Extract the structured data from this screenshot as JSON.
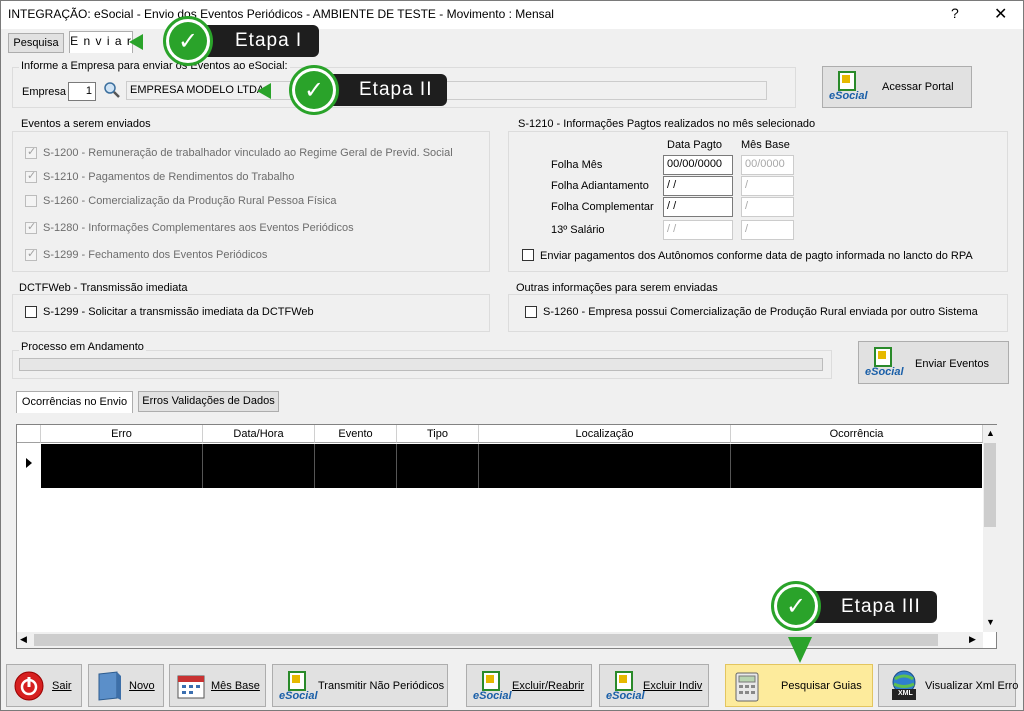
{
  "window": {
    "title": "INTEGRAÇÃO: eSocial - Envio dos Eventos Periódicos - AMBIENTE DE TESTE - Movimento : Mensal",
    "help": "?",
    "close": "✕"
  },
  "tabs": [
    {
      "label": "Pesquisa"
    },
    {
      "label": "E n v i a r"
    }
  ],
  "empresa_group": {
    "label": "Informe a Empresa para enviar os Eventos ao eSocial:",
    "empresa_label": "Empresa",
    "empresa_code": "1",
    "empresa_name": "EMPRESA MODELO LTDA"
  },
  "acessar_portal": {
    "label": "Acessar Portal",
    "logo_text": "eSocial"
  },
  "eventos_group": {
    "label": "Eventos a serem enviados",
    "items": [
      {
        "label": "S-1200 - Remuneração de trabalhador vinculado ao Regime Geral de Previd. Social",
        "checked": true
      },
      {
        "label": "S-1210 - Pagamentos de Rendimentos do Trabalho",
        "checked": true
      },
      {
        "label": "S-1260 - Comercialização da Produção Rural Pessoa Física",
        "checked": false
      },
      {
        "label": "S-1280 - Informações Complementares aos Eventos Periódicos",
        "checked": true
      },
      {
        "label": "S-1299 - Fechamento dos Eventos Periódicos",
        "checked": true
      }
    ]
  },
  "s1210_group": {
    "label": "S-1210 - Informações Pagtos realizados no mês selecionado",
    "col_data_pagto": "Data Pagto",
    "col_mes_base": "Mês Base",
    "rows": [
      {
        "label": "Folha Mês",
        "data_pagto": "00/00/0000",
        "mes_base": "00/0000"
      },
      {
        "label": "Folha Adiantamento",
        "data_pagto": " /  /",
        "mes_base": "  /"
      },
      {
        "label": "Folha Complementar",
        "data_pagto": " /  /",
        "mes_base": "  /"
      },
      {
        "label": "13º Salário",
        "data_pagto": " /  /",
        "mes_base": "  /"
      }
    ],
    "autonomos_label": "Enviar pagamentos dos Autônomos conforme data de pagto informada no lancto do RPA"
  },
  "dctfweb_group": {
    "label": "DCTFWeb - Transmissão imediata",
    "item": "S-1299 - Solicitar a transmissão imediata da DCTFWeb"
  },
  "outras_group": {
    "label": "Outras informações para serem enviadas",
    "item": "S-1260 - Empresa possui Comercialização de Produção Rural enviada por outro Sistema"
  },
  "processo_group": {
    "label": "Processo em Andamento",
    "progress": 0
  },
  "enviar_eventos": {
    "label": "Enviar Eventos",
    "logo_text": "eSocial"
  },
  "result_tabs": [
    {
      "label": "Ocorrências no Envio"
    },
    {
      "label": "Erros Validações de Dados"
    }
  ],
  "grid": {
    "columns": [
      "Erro",
      "Data/Hora",
      "Evento",
      "Tipo",
      "Localização",
      "Ocorrência"
    ]
  },
  "callouts": {
    "etapa1": "Etapa I",
    "etapa2": "Etapa II",
    "etapa3": "Etapa III"
  },
  "bottom_buttons": [
    {
      "label": "Sair",
      "icon": "power-icon"
    },
    {
      "label": "Novo",
      "icon": "new-doc-icon"
    },
    {
      "label": "Mês Base",
      "icon": "calendar-icon"
    },
    {
      "label": "Transmitir Não Periódicos",
      "icon": "esocial-icon",
      "logo_text": "eSocial"
    },
    {
      "label": "Excluir/Reabrir",
      "icon": "esocial-icon",
      "logo_text": "eSocial"
    },
    {
      "label": "Excluir Indiv",
      "icon": "esocial-icon",
      "logo_text": "eSocial"
    },
    {
      "label": "Pesquisar Guias",
      "icon": "calculator-icon"
    },
    {
      "label": "Visualizar Xml Erro",
      "icon": "xml-globe-icon",
      "icon_text": "XML"
    }
  ],
  "colors": {
    "accent_green": "#2aa32a",
    "highlight": "#fdeb9c"
  }
}
